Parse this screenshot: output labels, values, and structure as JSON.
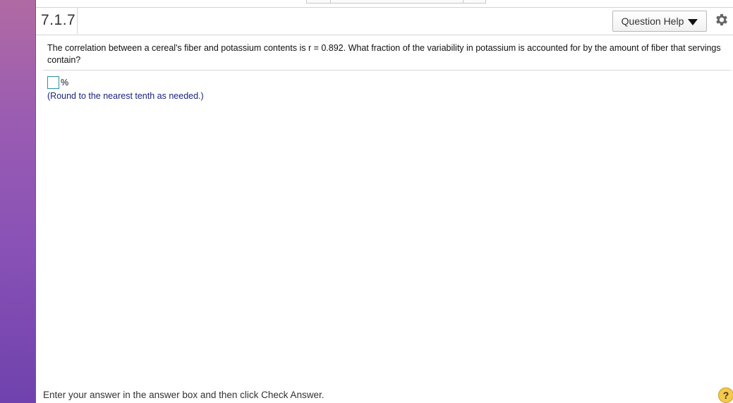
{
  "header": {
    "question_number": "7.1.7",
    "help_label": "Question Help"
  },
  "question": {
    "text": "The correlation between a cereal's fiber and potassium contents is r = 0.892. What fraction of the variability in potassium is accounted for by the amount of fiber that servings contain?"
  },
  "answer": {
    "value": "",
    "unit": "%",
    "note": "(Round to the nearest tenth as needed.)"
  },
  "footer": {
    "instructions": "Enter your answer in the answer box and then click Check Answer.",
    "help_symbol": "?"
  },
  "icons": {
    "settings": "gear-icon",
    "dropdown": "caret-down-icon",
    "help": "help-circle-icon"
  },
  "colors": {
    "answer_box_border": "#2c8ea4",
    "note_text": "#1a237e",
    "help_circle": "#f6c94a"
  }
}
